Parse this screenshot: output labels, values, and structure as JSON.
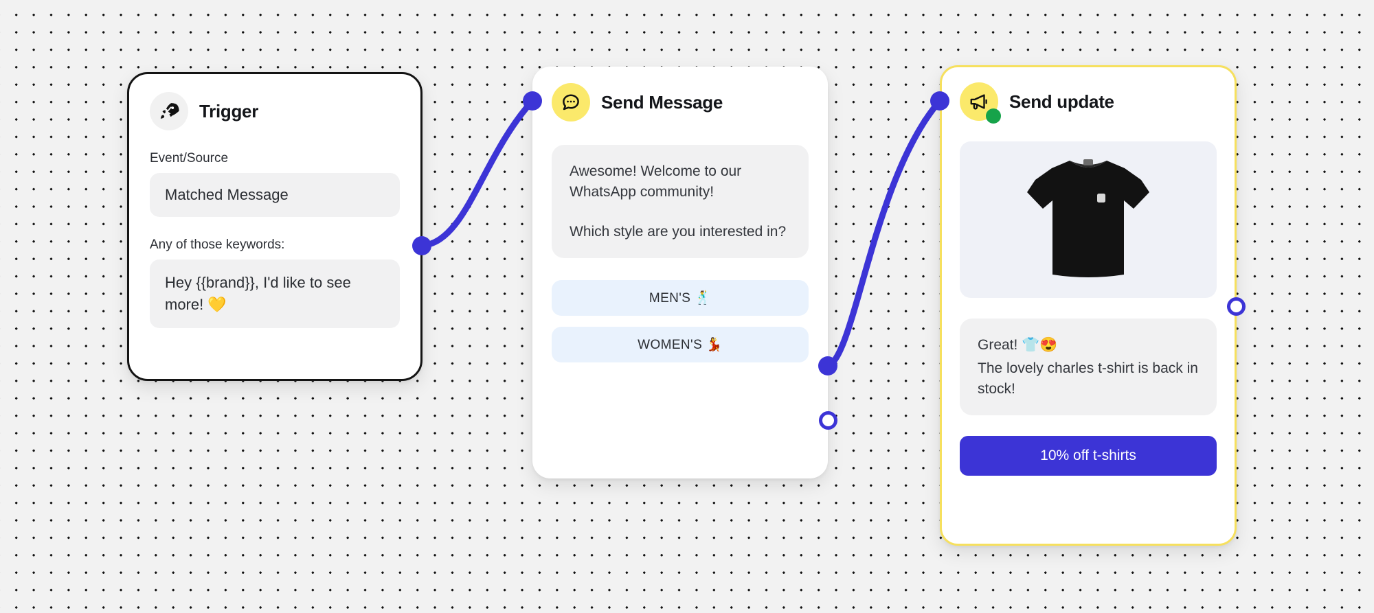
{
  "canvas": {
    "background_color": "#f2f2f2",
    "dot_color": "#111111",
    "accent_color": "#3c34d6",
    "selected_border_color": "#f6e05e"
  },
  "nodes": [
    {
      "id": "trigger",
      "title": "Trigger",
      "icon": "rocket-icon",
      "icon_bg": "#f1f1f1",
      "border_color": "#141414",
      "fields": [
        {
          "label": "Event/Source",
          "value": "Matched Message"
        },
        {
          "label": "Any of those keywords:",
          "value": "Hey {{brand}}, I'd like to see more! 💛"
        }
      ]
    },
    {
      "id": "send_message",
      "title": "Send Message",
      "icon": "chat-bubble-icon",
      "icon_bg": "#fbe96b",
      "message_lines": [
        "Awesome! Welcome to our WhatsApp community!",
        "Which style are you interested in?"
      ],
      "choices": [
        {
          "label": "MEN'S 🕺"
        },
        {
          "label": "WOMEN'S 💃"
        }
      ]
    },
    {
      "id": "send_update",
      "title": "Send update",
      "icon": "megaphone-icon",
      "icon_bg": "#fbe96b",
      "status": "active",
      "status_color": "#16a34a",
      "product_image_alt": "black-t-shirt",
      "message_lines": [
        "Great! 👕😍",
        "The lovely charles t-shirt is back in stock!"
      ],
      "cta": {
        "label": "10% off t-shirts",
        "color": "#3c34d6"
      }
    }
  ]
}
